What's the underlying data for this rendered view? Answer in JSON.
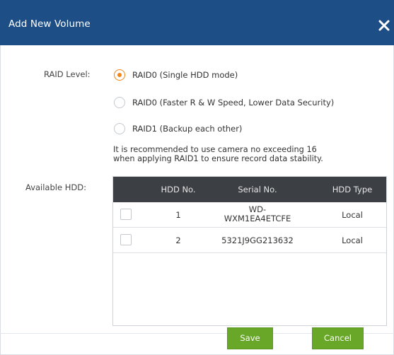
{
  "dialog": {
    "title": "Add New Volume",
    "close_icon": "close-icon"
  },
  "raid": {
    "label": "RAID Level:",
    "selected_index": 0,
    "options": [
      {
        "label": "RAID0 (Single HDD mode)",
        "checked": true
      },
      {
        "label": "RAID0 (Faster R & W Speed, Lower Data Security)",
        "checked": false
      },
      {
        "label": "RAID1 (Backup each other)",
        "checked": false
      }
    ],
    "note_line1": "It is recommended to use camera no exceeding 16",
    "note_line2": "when applying RAID1 to ensure record data stability."
  },
  "hdd": {
    "label": "Available HDD:",
    "columns": [
      "HDD No.",
      "Serial No.",
      "HDD Type"
    ],
    "rows": [
      {
        "checked": false,
        "no": "1",
        "serial_line1": "WD-",
        "serial_line2": "WXM1EA4ETCFE",
        "type": "Local"
      },
      {
        "checked": false,
        "no": "2",
        "serial": "5321J9GG213632",
        "type": "Local"
      }
    ]
  },
  "buttons": {
    "save": "Save",
    "cancel": "Cancel"
  },
  "colors": {
    "titlebar": "#1d4f86",
    "accent_radio": "#f0851a",
    "button_green": "#68a728",
    "table_header": "#3c3f44"
  }
}
